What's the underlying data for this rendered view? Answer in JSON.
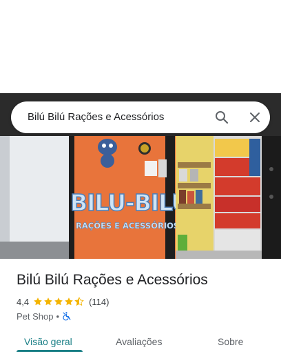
{
  "search": {
    "query": "Bilú Bilú Rações e Acessórios"
  },
  "place": {
    "name": "Bilú Bilú Rações e Acessórios",
    "rating": "4,4",
    "stars": 4.4,
    "review_count": "(114)",
    "category": "Pet Shop",
    "separator": "•",
    "accessibility_icon": "not-wheelchair-accessible-icon"
  },
  "photo": {
    "sign_line1": "BILU-BILU",
    "sign_line2": "RAÇÕES E ACESSÓRIOS"
  },
  "tabs": [
    {
      "label": "Visão geral",
      "active": true
    },
    {
      "label": "Avaliações",
      "active": false
    },
    {
      "label": "Sobre",
      "active": false
    }
  ],
  "colors": {
    "accent": "#1a7f86",
    "star": "#f4b400",
    "storefront": "#e8743b"
  }
}
